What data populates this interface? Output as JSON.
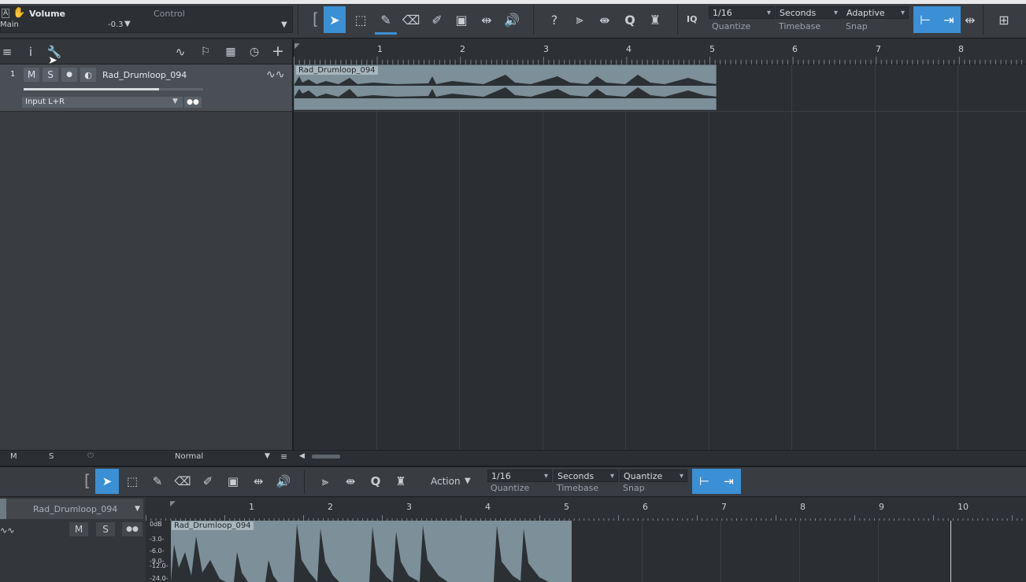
{
  "toolbar": {
    "param_name": "Volume",
    "param_track": "Main",
    "param_value": "-0.3",
    "control_label": "Control",
    "iq_label": "IQ",
    "quantize_value": "1/16",
    "quantize_label": "Quantize",
    "timebase_value": "Seconds",
    "timebase_label": "Timebase",
    "snap_value": "Adaptive",
    "snap_label": "Snap"
  },
  "ruler": {
    "ticks": [
      "1",
      "2",
      "3",
      "4",
      "5",
      "6",
      "7",
      "8"
    ]
  },
  "track": {
    "number": "1",
    "mute": "M",
    "solo": "S",
    "name": "Rad_Drumloop_094",
    "input": "Input L+R"
  },
  "clip": {
    "name": "Rad_Drumloop_094"
  },
  "status": {
    "m": "M",
    "s": "S",
    "mode": "Normal"
  },
  "editor": {
    "action_label": "Action",
    "quantize_value": "1/16",
    "quantize_label": "Quantize",
    "timebase_value": "Seconds",
    "timebase_label": "Timebase",
    "snap_value": "Quantize",
    "snap_label": "Snap",
    "track_name": "Rad_Drumloop_094",
    "mute": "M",
    "solo": "S",
    "ruler_ticks": [
      "1",
      "2",
      "3",
      "4",
      "5",
      "6",
      "7",
      "8",
      "9",
      "10"
    ],
    "db_labels": [
      "0dB",
      "-3.0-",
      "-6.0-",
      "-9.0-",
      "-12.0-",
      "-24.0-"
    ]
  }
}
